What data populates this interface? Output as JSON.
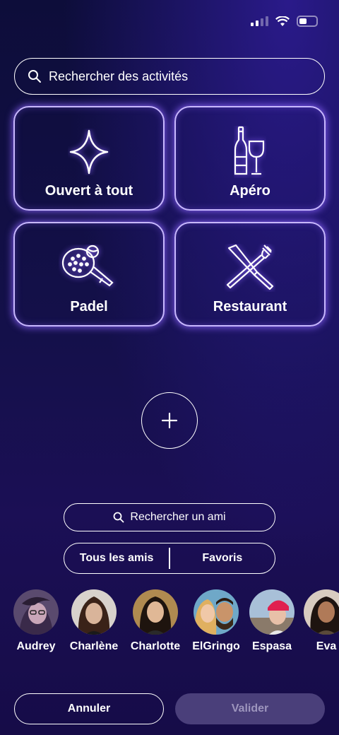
{
  "search": {
    "placeholder": "Rechercher des activités",
    "icon": "search-icon"
  },
  "activities": [
    {
      "label": "Ouvert à tout",
      "icon": "sparkle-icon"
    },
    {
      "label": "Apéro",
      "icon": "wine-icon"
    },
    {
      "label": "Padel",
      "icon": "padel-racket-icon"
    },
    {
      "label": "Restaurant",
      "icon": "fork-knife-icon"
    }
  ],
  "add_button": {
    "icon": "plus-icon"
  },
  "friend_search": {
    "label": "Rechercher un ami",
    "icon": "search-icon"
  },
  "tabs": {
    "all": "Tous les amis",
    "favorites": "Favoris"
  },
  "friends": [
    {
      "name": "Audrey",
      "color": "#5a4a6e"
    },
    {
      "name": "Charlène",
      "color": "#4a2f26"
    },
    {
      "name": "Charlotte",
      "color": "#3b2a1e"
    },
    {
      "name": "ElGringo",
      "color": "#8a5b3c"
    },
    {
      "name": "Espasa",
      "color": "#7a8aa0"
    },
    {
      "name": "Eva",
      "color": "#3a2a24"
    }
  ],
  "actions": {
    "cancel": "Annuler",
    "validate": "Valider"
  },
  "colors": {
    "accent_glow": "#8c64ff",
    "tile_border": "#c8b8ff",
    "disabled_button": "#4a3f7a"
  }
}
